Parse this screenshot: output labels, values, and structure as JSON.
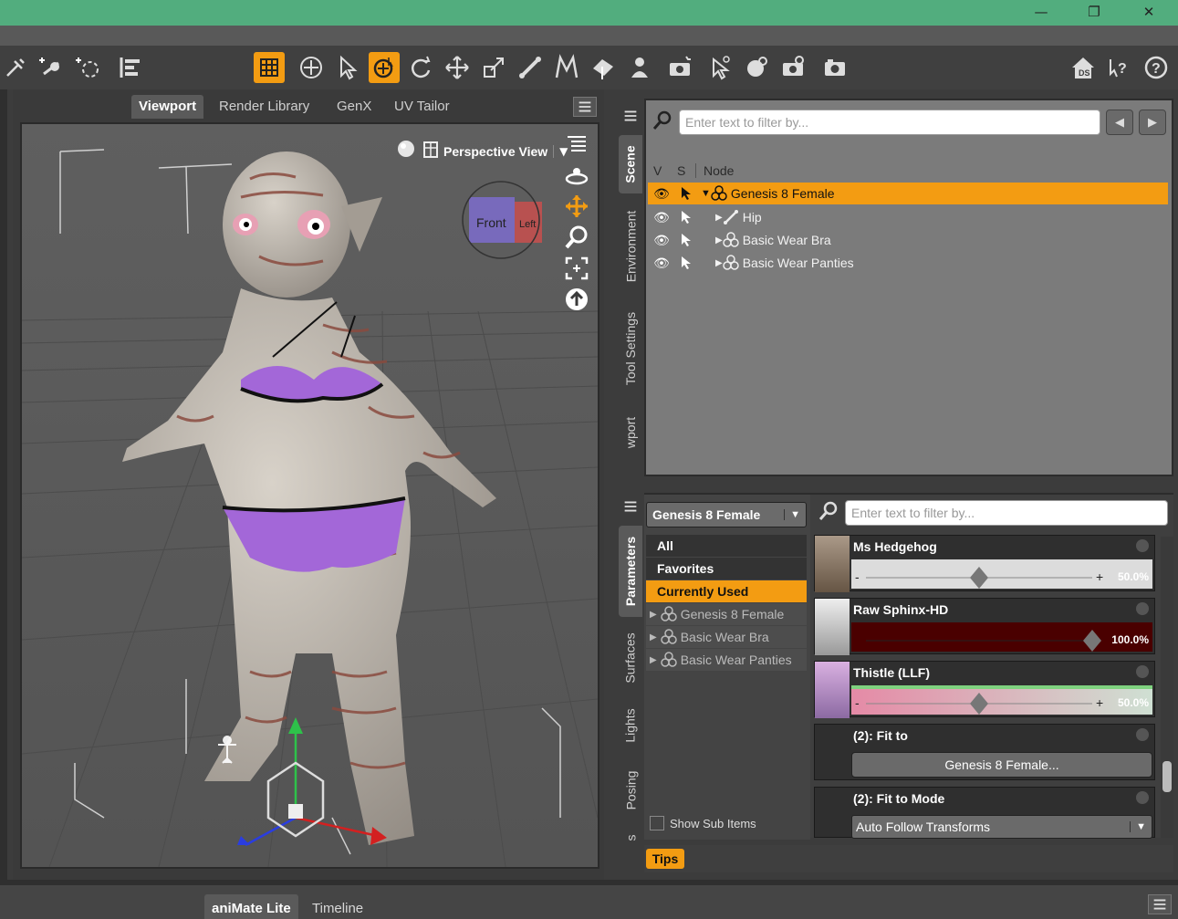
{
  "window": {
    "minimize": "—",
    "restore": "❐",
    "close": "✕"
  },
  "toolbar": {
    "icons": [
      "universal-pin-icon",
      "node-weight-icon",
      "joint-editor-icon",
      "align-icon",
      "region-nav-icon",
      "active-pose-icon",
      "node-selection-icon",
      "universal-tool-icon",
      "rotate-icon",
      "translate-icon",
      "scale-icon",
      "bone-tool-icon",
      "morph-tool-icon",
      "surface-selection-icon",
      "figure-setup-icon",
      "render-icon",
      "tool-select-icon",
      "spot-render-icon",
      "render-settings-icon",
      "render-window-icon",
      "ds-home-icon",
      "whats-this-icon",
      "help-icon"
    ]
  },
  "viewport": {
    "tabs": [
      "Viewport",
      "Render Library",
      "GenX",
      "UV Tailor"
    ],
    "active_tab": "Viewport",
    "camera": "Perspective View",
    "cube_front": "Front",
    "cube_left": "Left"
  },
  "right_tabs_top": [
    "Scene",
    "Environment",
    "Tool Settings",
    "wport"
  ],
  "scene": {
    "search_placeholder": "Enter text to filter by...",
    "columns": {
      "v": "V",
      "s": "S",
      "node": "Node"
    },
    "nodes": [
      {
        "label": "Genesis 8 Female",
        "selected": true,
        "indent": 0,
        "expanded": true
      },
      {
        "label": "Hip",
        "selected": false,
        "indent": 1,
        "expanded": false
      },
      {
        "label": "Basic Wear Bra",
        "selected": false,
        "indent": 1,
        "expanded": false
      },
      {
        "label": "Basic Wear Panties",
        "selected": false,
        "indent": 1,
        "expanded": false
      }
    ]
  },
  "right_tabs_bottom": [
    "Parameters",
    "Surfaces",
    "Lights",
    "Posing",
    "s"
  ],
  "parameters": {
    "figure": "Genesis 8 Female",
    "search_placeholder": "Enter text to filter by...",
    "categories": [
      "All",
      "Favorites",
      "Currently Used"
    ],
    "selected_category": "Currently Used",
    "nodes": [
      "Genesis 8 Female",
      "Basic Wear Bra",
      "Basic Wear Panties"
    ],
    "show_sub_items": "Show Sub Items",
    "sliders": [
      {
        "name": "Ms Hedgehog",
        "value": "50.0%",
        "fraction": 0.5,
        "color": "#dcdcdc"
      },
      {
        "name": "Raw Sphinx-HD",
        "value": "100.0%",
        "fraction": 1.0,
        "color": "#6b0000"
      },
      {
        "name": "Thistle (LLF)",
        "value": "50.0%",
        "fraction": 0.5,
        "color": "#d98fa6"
      }
    ],
    "fit_to": {
      "title": "(2): Fit to",
      "button": "Genesis 8 Female..."
    },
    "fit_mode": {
      "title": "(2): Fit to Mode",
      "value": "Auto Follow Transforms"
    },
    "tips": "Tips"
  },
  "bottom_tabs": [
    "aniMate Lite",
    "Timeline"
  ],
  "accent": "#f39c12",
  "titlebar_color": "#52ad7e"
}
